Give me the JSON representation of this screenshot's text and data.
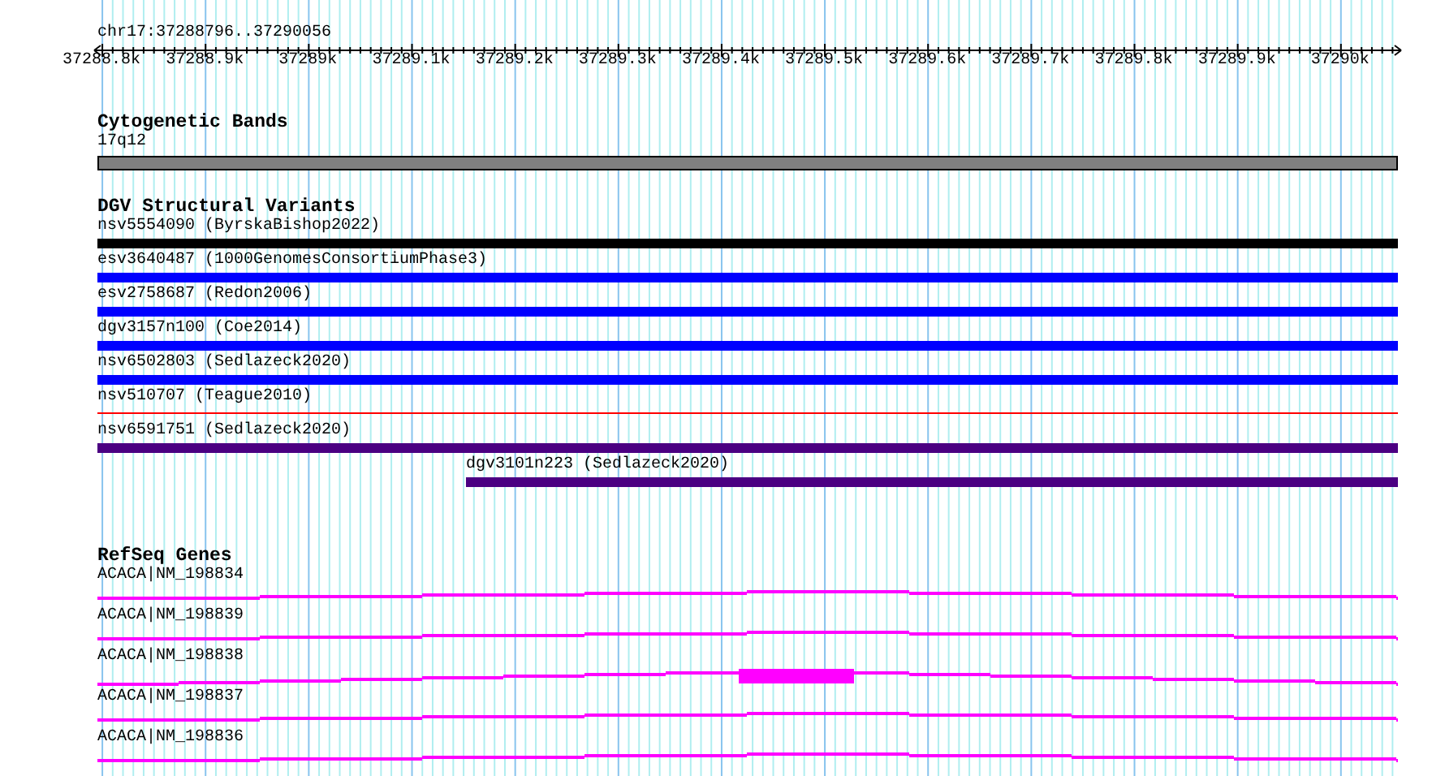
{
  "location": "chr17:37288796..37290056",
  "axis": {
    "ticks": [
      "37288.8k",
      "37288.9k",
      "37289k",
      "37289.1k",
      "37289.2k",
      "37289.3k",
      "37289.4k",
      "37289.5k",
      "37289.6k",
      "37289.7k",
      "37289.8k",
      "37289.9k",
      "37290k"
    ]
  },
  "tracks": [
    {
      "title": "Cytogenetic Bands",
      "kind": "bands",
      "features": [
        {
          "label": "17q12",
          "kind": "band",
          "color": "#808080"
        }
      ]
    },
    {
      "title": "DGV Structural Variants",
      "kind": "variants",
      "features": [
        {
          "label": "nsv5554090 (ByrskaBishop2022)",
          "kind": "bar",
          "color": "#000000"
        },
        {
          "label": "esv3640487 (1000GenomesConsortiumPhase3)",
          "kind": "bar",
          "color": "#0000ff"
        },
        {
          "label": "esv2758687 (Redon2006)",
          "kind": "bar",
          "color": "#0000ff"
        },
        {
          "label": "dgv3157n100 (Coe2014)",
          "kind": "bar",
          "color": "#0000ff"
        },
        {
          "label": "nsv6502803 (Sedlazeck2020)",
          "kind": "bar",
          "color": "#0000ff"
        },
        {
          "label": "nsv510707 (Teague2010)",
          "kind": "line",
          "color": "#ff0000"
        },
        {
          "label": "nsv6591751 (Sedlazeck2020)",
          "kind": "bar",
          "color": "#4b0082"
        },
        {
          "label": "dgv3101n223 (Sedlazeck2020)",
          "kind": "bar",
          "color": "#4b0082",
          "level": 0.7166
        }
      ]
    },
    {
      "title": "RefSeq Genes",
      "kind": "genes",
      "features": [
        {
          "label": "ACACA|NM_198834",
          "kind": "gene",
          "color": "#ff00ff"
        },
        {
          "label": "ACACA|NM_198839",
          "kind": "gene",
          "color": "#ff00ff"
        },
        {
          "label": "ACACA|NM_198838",
          "kind": "gene-exon",
          "color": "#ff00ff"
        },
        {
          "label": "ACACA|NM_198837",
          "kind": "gene",
          "color": "#ff00ff"
        },
        {
          "label": "ACACA|NM_198836",
          "kind": "gene",
          "color": "#ff00ff"
        }
      ]
    }
  ]
}
